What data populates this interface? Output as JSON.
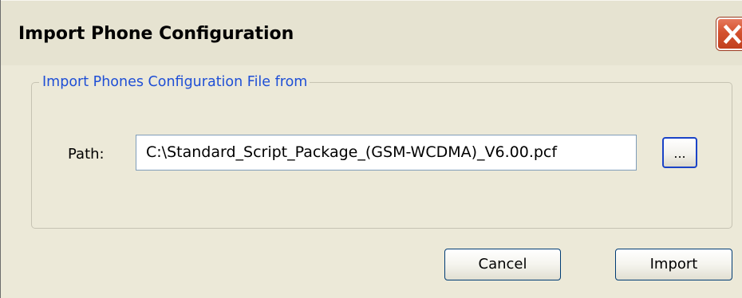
{
  "dialog": {
    "title": "Import Phone Configuration",
    "close_icon": "close-icon"
  },
  "group": {
    "legend": "Import Phones Configuration File from"
  },
  "path": {
    "label": "Path:",
    "value": "C:\\Standard_Script_Package_(GSM-WCDMA)_V6.00.pcf"
  },
  "browse": {
    "label": "..."
  },
  "buttons": {
    "cancel": "Cancel",
    "import": "Import"
  },
  "colors": {
    "dialog_background": "#ECE9D8",
    "legend_text": "#1f4fd6",
    "close_button": "#d4512e"
  }
}
